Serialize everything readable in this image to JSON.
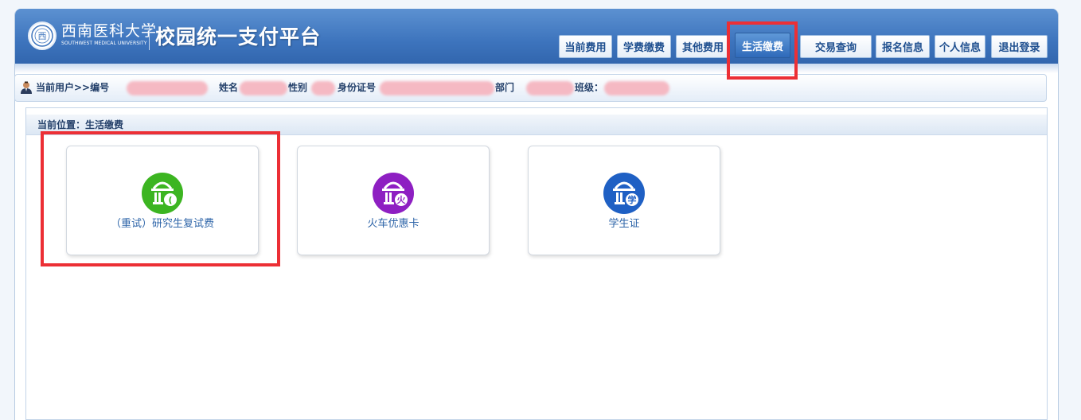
{
  "logo": {
    "seal_char": "西",
    "cn_name": "西南医科大学",
    "en_name": "SOUTHWEST MEDICAL UNIVERSITY",
    "platform_title": "校园统一支付平台"
  },
  "nav": {
    "tabs": [
      {
        "label": "当前费用"
      },
      {
        "label": "学费缴费"
      },
      {
        "label": "其他费用"
      },
      {
        "label": "生活缴费",
        "active": true
      },
      {
        "label": "交易查询"
      },
      {
        "label": "报名信息"
      },
      {
        "label": "个人信息"
      },
      {
        "label": "退出登录"
      }
    ]
  },
  "user": {
    "current_user_label": "当前用户>>编号",
    "name_label": "姓名",
    "gender_label": "性别",
    "id_label": "身份证号",
    "dept_label": "部门",
    "class_label": "班级："
  },
  "breadcrumb": "当前位置：生活缴费",
  "cards": [
    {
      "label": "（重试）研究生复试费",
      "icon": "basket-icon",
      "badge": "(",
      "color": "#3cb521"
    },
    {
      "label": "火车优惠卡",
      "icon": "basket-icon",
      "badge": "火",
      "color": "#8e1fc2"
    },
    {
      "label": "学生证",
      "icon": "basket-icon",
      "badge": "学",
      "color": "#1f60c4"
    }
  ],
  "colors": {
    "header": "#3d74bd",
    "highlight": "#ec2f35",
    "active_tab": "#2f6aba"
  }
}
